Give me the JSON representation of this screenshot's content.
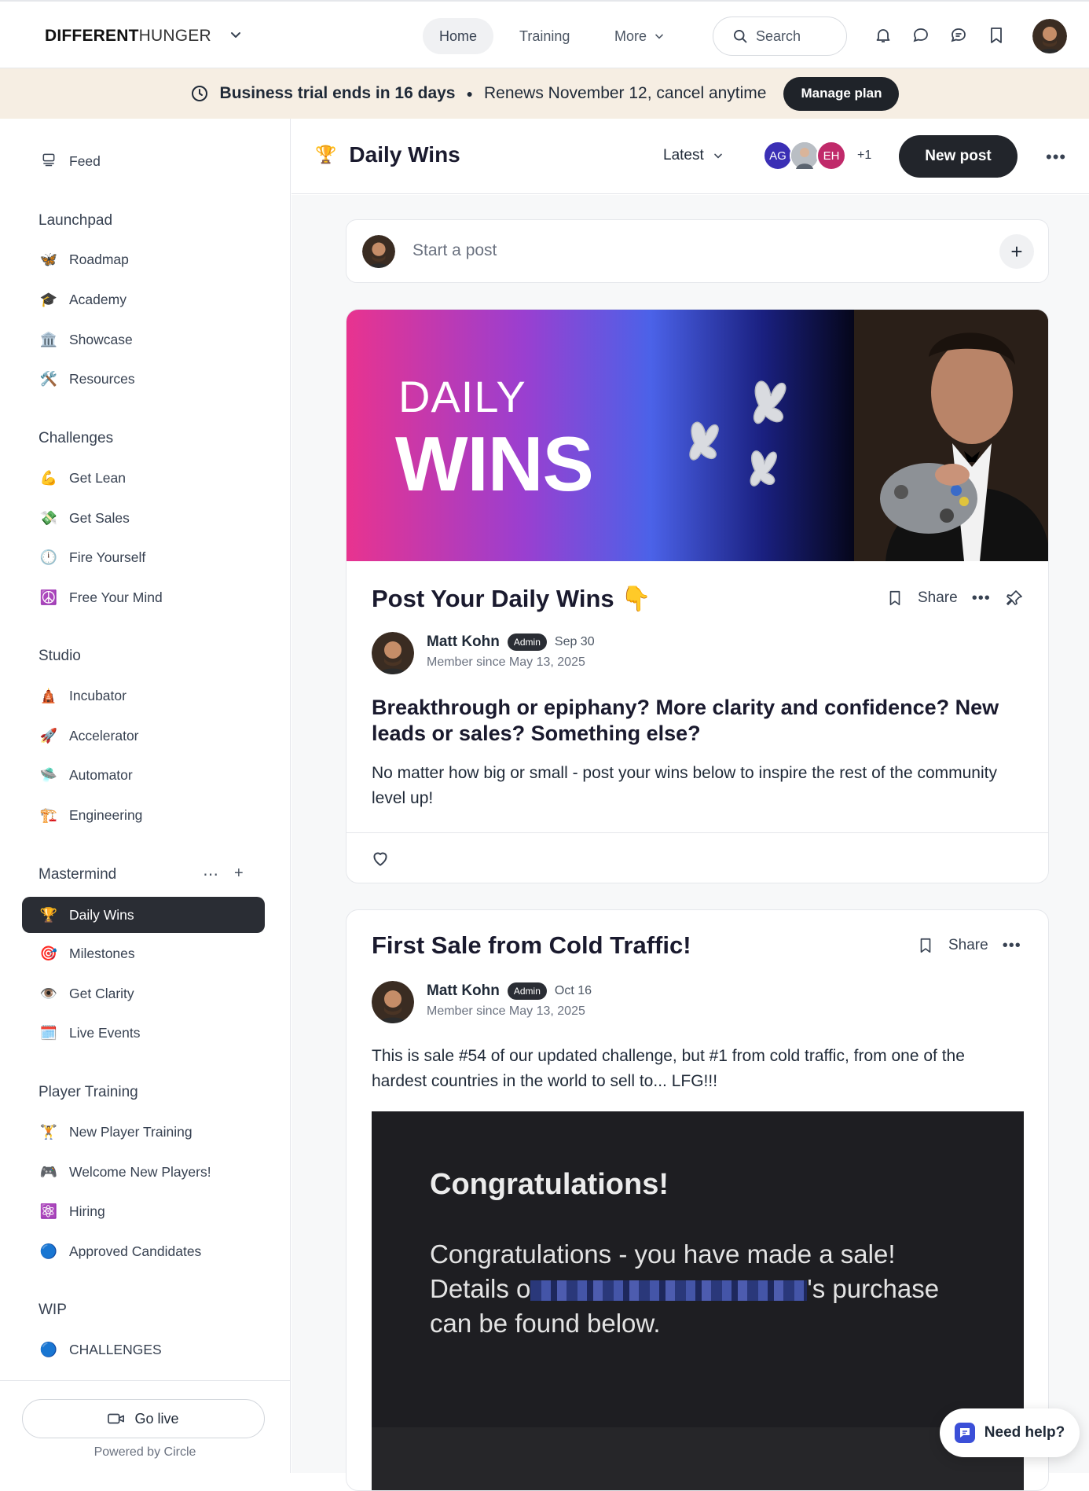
{
  "brand": {
    "bold": "DIFFERENT",
    "light": "HUNGER"
  },
  "nav": {
    "home": "Home",
    "training": "Training",
    "more": "More",
    "search_placeholder": "Search"
  },
  "banner": {
    "trial": "Business trial ends in 16 days",
    "renews": "Renews November 12, cancel anytime",
    "manage": "Manage plan"
  },
  "sidebar": {
    "feed": "Feed",
    "sections": [
      {
        "title": "Launchpad",
        "items": [
          {
            "icon": "🦋",
            "label": "Roadmap"
          },
          {
            "icon": "🎓",
            "label": "Academy"
          },
          {
            "icon": "🏛️",
            "label": "Showcase"
          },
          {
            "icon": "🛠️",
            "label": "Resources"
          }
        ]
      },
      {
        "title": "Challenges",
        "items": [
          {
            "icon": "💪",
            "label": "Get Lean"
          },
          {
            "icon": "💸",
            "label": "Get Sales"
          },
          {
            "icon": "🕛",
            "label": "Fire Yourself"
          },
          {
            "icon": "☮️",
            "label": "Free Your Mind"
          }
        ]
      },
      {
        "title": "Studio",
        "items": [
          {
            "icon": "🛕",
            "label": "Incubator"
          },
          {
            "icon": "🚀",
            "label": "Accelerator"
          },
          {
            "icon": "🛸",
            "label": "Automator"
          },
          {
            "icon": "🏗️",
            "label": "Engineering"
          }
        ]
      },
      {
        "title": "Mastermind",
        "items": [
          {
            "icon": "🏆",
            "label": "Daily Wins"
          },
          {
            "icon": "🎯",
            "label": "Milestones"
          },
          {
            "icon": "👁️",
            "label": "Get Clarity"
          },
          {
            "icon": "🗓️",
            "label": "Live Events"
          }
        ]
      },
      {
        "title": "Player Training",
        "items": [
          {
            "icon": "🏋️",
            "label": "New Player Training"
          },
          {
            "icon": "🎮",
            "label": "Welcome New Players!"
          },
          {
            "icon": "⚛️",
            "label": "Hiring"
          },
          {
            "icon": "🔵",
            "label": "Approved Candidates"
          }
        ]
      },
      {
        "title": "WIP",
        "items": [
          {
            "icon": "🔵",
            "label": "CHALLENGES"
          }
        ]
      }
    ],
    "go_live": "Go live",
    "powered": "Powered by Circle"
  },
  "space": {
    "icon": "🏆",
    "title": "Daily Wins",
    "sort": "Latest",
    "members": [
      {
        "initials": "AG",
        "color": "#3b2fb5"
      },
      {
        "initials": "",
        "color": "#9aa3ad"
      },
      {
        "initials": "EH",
        "color": "#c02a6a"
      }
    ],
    "more_count": "+1",
    "new_post": "New post"
  },
  "composer": {
    "placeholder": "Start a post"
  },
  "posts": [
    {
      "banner_daily": "DAILY",
      "banner_wins": "WINS",
      "title": "Post Your Daily Wins 👇",
      "share": "Share",
      "author": "Matt Kohn",
      "badge": "Admin",
      "date": "Sep 30",
      "since": "Member since May 13, 2025",
      "heading": "Breakthrough or epiphany? More clarity and confidence? New leads or sales? Something else?",
      "body": "No matter how big or small - post your wins below to inspire the rest of the community level up!"
    },
    {
      "title": "First Sale from Cold Traffic!",
      "share": "Share",
      "author": "Matt Kohn",
      "badge": "Admin",
      "date": "Oct 16",
      "since": "Member since May 13, 2025",
      "body": "This is sale #54 of our updated challenge, but #1 from cold traffic, from one of the hardest countries in the world to sell to... LFG!!!",
      "image_title": "Congratulations!",
      "image_line1": "Congratulations - you have made a sale!",
      "image_line2_a": "Details o",
      "image_line2_b": "'s purchase",
      "image_line3": "can be found below."
    }
  ],
  "help": "Need help?"
}
